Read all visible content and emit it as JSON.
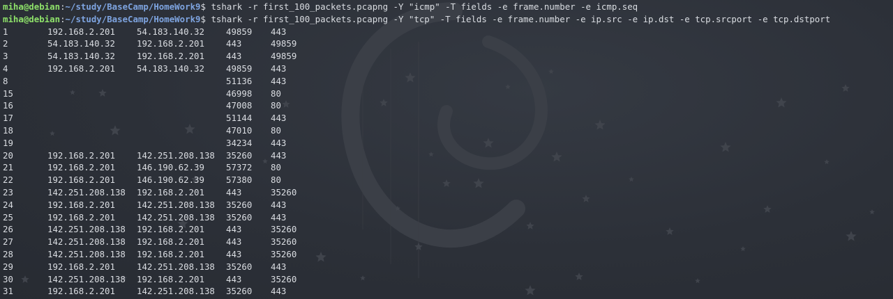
{
  "prompt": {
    "user_host": "miha@debian",
    "colon": ":",
    "path": "~/study/BaseCamp/HomeWork9",
    "dollar": "$"
  },
  "commands": [
    "tshark -r first_100_packets.pcapng -Y \"icmp\" -T fields -e frame.number -e icmp.seq",
    "tshark -r first_100_packets.pcapng -Y \"tcp\" -T fields -e frame.number -e ip.src -e ip.dst -e tcp.srcport -e tcp.dstport"
  ],
  "rows": [
    [
      "1",
      "192.168.2.201",
      "54.183.140.32",
      "49859",
      "443"
    ],
    [
      "2",
      "54.183.140.32",
      "192.168.2.201",
      "443",
      "49859"
    ],
    [
      "3",
      "54.183.140.32",
      "192.168.2.201",
      "443",
      "49859"
    ],
    [
      "4",
      "192.168.2.201",
      "54.183.140.32",
      "49859",
      "443"
    ],
    [
      "8",
      "",
      "",
      "51136",
      "443"
    ],
    [
      "15",
      "",
      "",
      "46998",
      "80"
    ],
    [
      "16",
      "",
      "",
      "47008",
      "80"
    ],
    [
      "17",
      "",
      "",
      "51144",
      "443"
    ],
    [
      "18",
      "",
      "",
      "47010",
      "80"
    ],
    [
      "19",
      "",
      "",
      "34234",
      "443"
    ],
    [
      "20",
      "192.168.2.201",
      "142.251.208.138",
      "35260",
      "443"
    ],
    [
      "21",
      "192.168.2.201",
      "146.190.62.39",
      "57372",
      "80"
    ],
    [
      "22",
      "192.168.2.201",
      "146.190.62.39",
      "57380",
      "80"
    ],
    [
      "23",
      "142.251.208.138",
      "192.168.2.201",
      "443",
      "35260"
    ],
    [
      "24",
      "192.168.2.201",
      "142.251.208.138",
      "35260",
      "443"
    ],
    [
      "25",
      "192.168.2.201",
      "142.251.208.138",
      "35260",
      "443"
    ],
    [
      "26",
      "142.251.208.138",
      "192.168.2.201",
      "443",
      "35260"
    ],
    [
      "27",
      "142.251.208.138",
      "192.168.2.201",
      "443",
      "35260"
    ],
    [
      "28",
      "142.251.208.138",
      "192.168.2.201",
      "443",
      "35260"
    ],
    [
      "29",
      "192.168.2.201",
      "142.251.208.138",
      "35260",
      "443"
    ],
    [
      "30",
      "142.251.208.138",
      "192.168.2.201",
      "443",
      "35260"
    ],
    [
      "31",
      "192.168.2.201",
      "142.251.208.138",
      "35260",
      "443"
    ]
  ],
  "colors": {
    "background": "#2c3038",
    "text": "#dadde2",
    "prompt_user": "#8ee26a",
    "prompt_path": "#7ea4e0"
  },
  "wallpaper": {
    "logo": "debian-swirl-icon",
    "decor": "star-icon"
  }
}
